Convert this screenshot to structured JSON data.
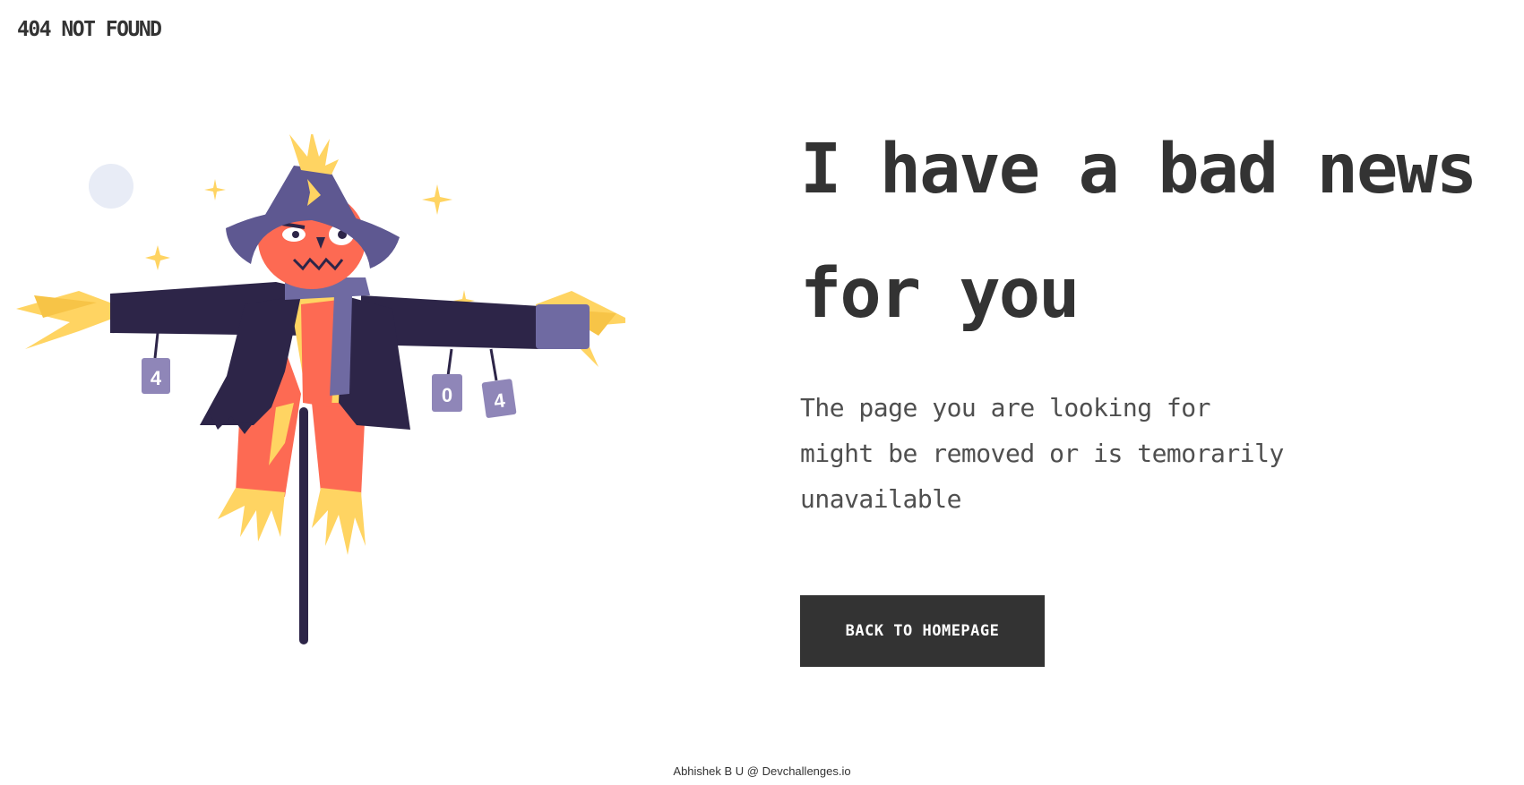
{
  "header": {
    "brand": "404 NOT FOUND"
  },
  "illustration": {
    "can_labels": [
      "4",
      "0",
      "4"
    ]
  },
  "main": {
    "headline_lines": [
      "I have a bad news",
      "for you"
    ],
    "message_lines": [
      "The page you are looking for",
      "might be removed or is temorarily",
      "unavailable"
    ],
    "button_label": "BACK TO HOMEPAGE"
  },
  "footer": {
    "credit": "Abhishek B U @ Devchallenges.io"
  },
  "colors": {
    "text": "#333333",
    "button_bg": "#333333",
    "button_text": "#ffffff",
    "hat": "#5e5891",
    "coat": "#2d2548",
    "pumpkin": "#fd6a53",
    "straw": "#ffd462",
    "can": "#8f86b8",
    "moon": "#e8ecf6"
  }
}
